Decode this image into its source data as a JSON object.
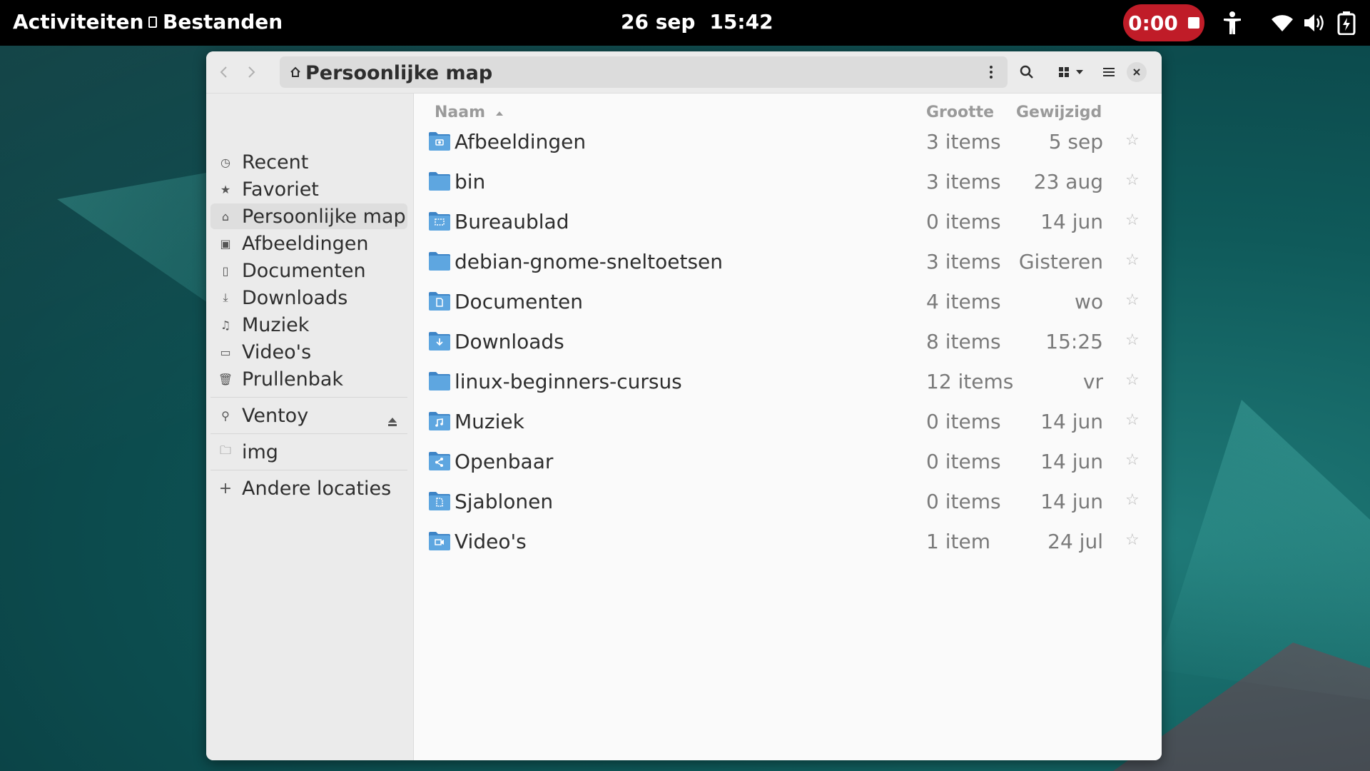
{
  "topbar": {
    "activities": "Activiteiten",
    "app_name": "Bestanden",
    "date": "26 sep",
    "time": "15:42",
    "recording_time": "0:00",
    "recording_color": "#c01c28",
    "tray_icons": [
      "accessibility-icon",
      "wifi-icon",
      "volume-icon",
      "battery-icon"
    ]
  },
  "window": {
    "path_title": "Persoonlijke map",
    "header_icons": [
      "back-icon",
      "forward-icon",
      "home-icon",
      "kebab-menu-icon",
      "search-icon",
      "grid-view-icon",
      "view-options-icon",
      "hamburger-menu-icon",
      "close-icon"
    ]
  },
  "sidebar": {
    "places": [
      {
        "label": "Recent",
        "icon": "recent-icon"
      },
      {
        "label": "Favoriet",
        "icon": "star-icon"
      },
      {
        "label": "Persoonlijke map",
        "icon": "home-icon",
        "active": true
      },
      {
        "label": "Afbeeldingen",
        "icon": "image-icon"
      },
      {
        "label": "Documenten",
        "icon": "document-icon"
      },
      {
        "label": "Downloads",
        "icon": "download-icon"
      },
      {
        "label": "Muziek",
        "icon": "music-icon"
      },
      {
        "label": "Video's",
        "icon": "video-icon"
      },
      {
        "label": "Prullenbak",
        "icon": "trash-icon"
      }
    ],
    "devices": [
      {
        "label": "Ventoy",
        "icon": "usb-icon"
      }
    ],
    "bookmarks": [
      {
        "label": "img",
        "icon": "folder-icon"
      }
    ],
    "other": {
      "label": "Andere locaties",
      "icon": "plus-icon"
    }
  },
  "list": {
    "columns": {
      "name": "Naam",
      "size": "Grootte",
      "modified": "Gewijzigd"
    },
    "sort": {
      "column": "name",
      "direction": "ascending"
    },
    "rows": [
      {
        "name": "Afbeeldingen",
        "size": "3 items",
        "modified": "5 sep",
        "emblem": "camera"
      },
      {
        "name": "bin",
        "size": "3 items",
        "modified": "23 aug",
        "emblem": ""
      },
      {
        "name": "Bureaublad",
        "size": "0 items",
        "modified": "14 jun",
        "emblem": "desktop"
      },
      {
        "name": "debian-gnome-sneltoetsen",
        "size": "3 items",
        "modified": "Gisteren",
        "emblem": ""
      },
      {
        "name": "Documenten",
        "size": "4 items",
        "modified": "wo",
        "emblem": "document"
      },
      {
        "name": "Downloads",
        "size": "8 items",
        "modified": "15:25",
        "emblem": "download"
      },
      {
        "name": "linux-beginners-cursus",
        "size": "12 items",
        "modified": "vr",
        "emblem": ""
      },
      {
        "name": "Muziek",
        "size": "0 items",
        "modified": "14 jun",
        "emblem": "music"
      },
      {
        "name": "Openbaar",
        "size": "0 items",
        "modified": "14 jun",
        "emblem": "share"
      },
      {
        "name": "Sjablonen",
        "size": "0 items",
        "modified": "14 jun",
        "emblem": "template"
      },
      {
        "name": "Video's",
        "size": "1 item",
        "modified": "24 jul",
        "emblem": "video"
      }
    ]
  },
  "colors": {
    "folder_blue": "#5ea6e0",
    "folder_dark": "#3d84c6",
    "accent_selected": "#dedede"
  }
}
